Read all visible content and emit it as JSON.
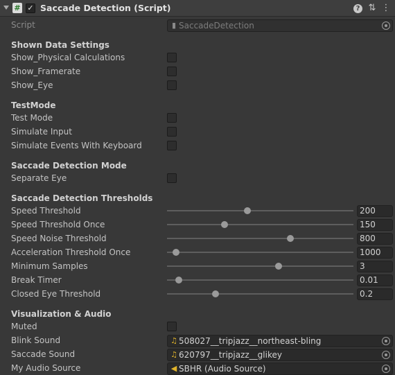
{
  "header": {
    "title": "Saccade Detection (Script)",
    "script_icon": "#",
    "enabled_mark": "✓",
    "help_icon_glyph": "?",
    "settings_icon_glyph": "⇅",
    "menu_icon_glyph": "⋮"
  },
  "script_field": {
    "label": "Script",
    "value": "SaccadeDetection"
  },
  "sections": {
    "shown_data": "Shown Data Settings",
    "test_mode": "TestMode",
    "detection_mode": "Saccade Detection Mode",
    "thresholds": "Saccade Detection Thresholds",
    "visualization": "Visualization & Audio"
  },
  "toggles": {
    "show_physical": {
      "label": "Show_Physical Calculations",
      "checked": false
    },
    "show_framerate": {
      "label": "Show_Framerate",
      "checked": false
    },
    "show_eye": {
      "label": "Show_Eye",
      "checked": false
    },
    "test_mode": {
      "label": "Test Mode",
      "checked": false
    },
    "simulate_input": {
      "label": "Simulate Input",
      "checked": false
    },
    "simulate_events": {
      "label": "Simulate Events With Keyboard",
      "checked": false
    },
    "separate_eye": {
      "label": "Separate Eye",
      "checked": false
    },
    "muted": {
      "label": "Muted",
      "checked": false
    }
  },
  "sliders": [
    {
      "label": "Speed Threshold",
      "value": "200",
      "fraction": 0.43
    },
    {
      "label": "Speed Threshold Once",
      "value": "150",
      "fraction": 0.31
    },
    {
      "label": "Speed Noise Threshold",
      "value": "800",
      "fraction": 0.66
    },
    {
      "label": "Acceleration Threshold Once",
      "value": "1000",
      "fraction": 0.05
    },
    {
      "label": "Minimum Samples",
      "value": "3",
      "fraction": 0.6
    },
    {
      "label": "Break Timer",
      "value": "0.01",
      "fraction": 0.065
    },
    {
      "label": "Closed Eye Threshold",
      "value": "0.2",
      "fraction": 0.26
    }
  ],
  "audio": {
    "blink_sound": {
      "label": "Blink Sound",
      "value": "508027__tripjazz__northeast-bling",
      "icon": "audio-clip-icon"
    },
    "saccade_sound": {
      "label": "Saccade Sound",
      "value": "620797__tripjazz__glikey",
      "icon": "audio-clip-icon"
    },
    "my_audio_source": {
      "label": "My Audio Source",
      "value": "SBHR (Audio Source)",
      "icon": "audio-source-icon"
    }
  },
  "colors": {
    "background": "#383838",
    "header": "#3e3e3e",
    "field": "#2a2a2a",
    "asset_icon": "#e2b42a"
  }
}
